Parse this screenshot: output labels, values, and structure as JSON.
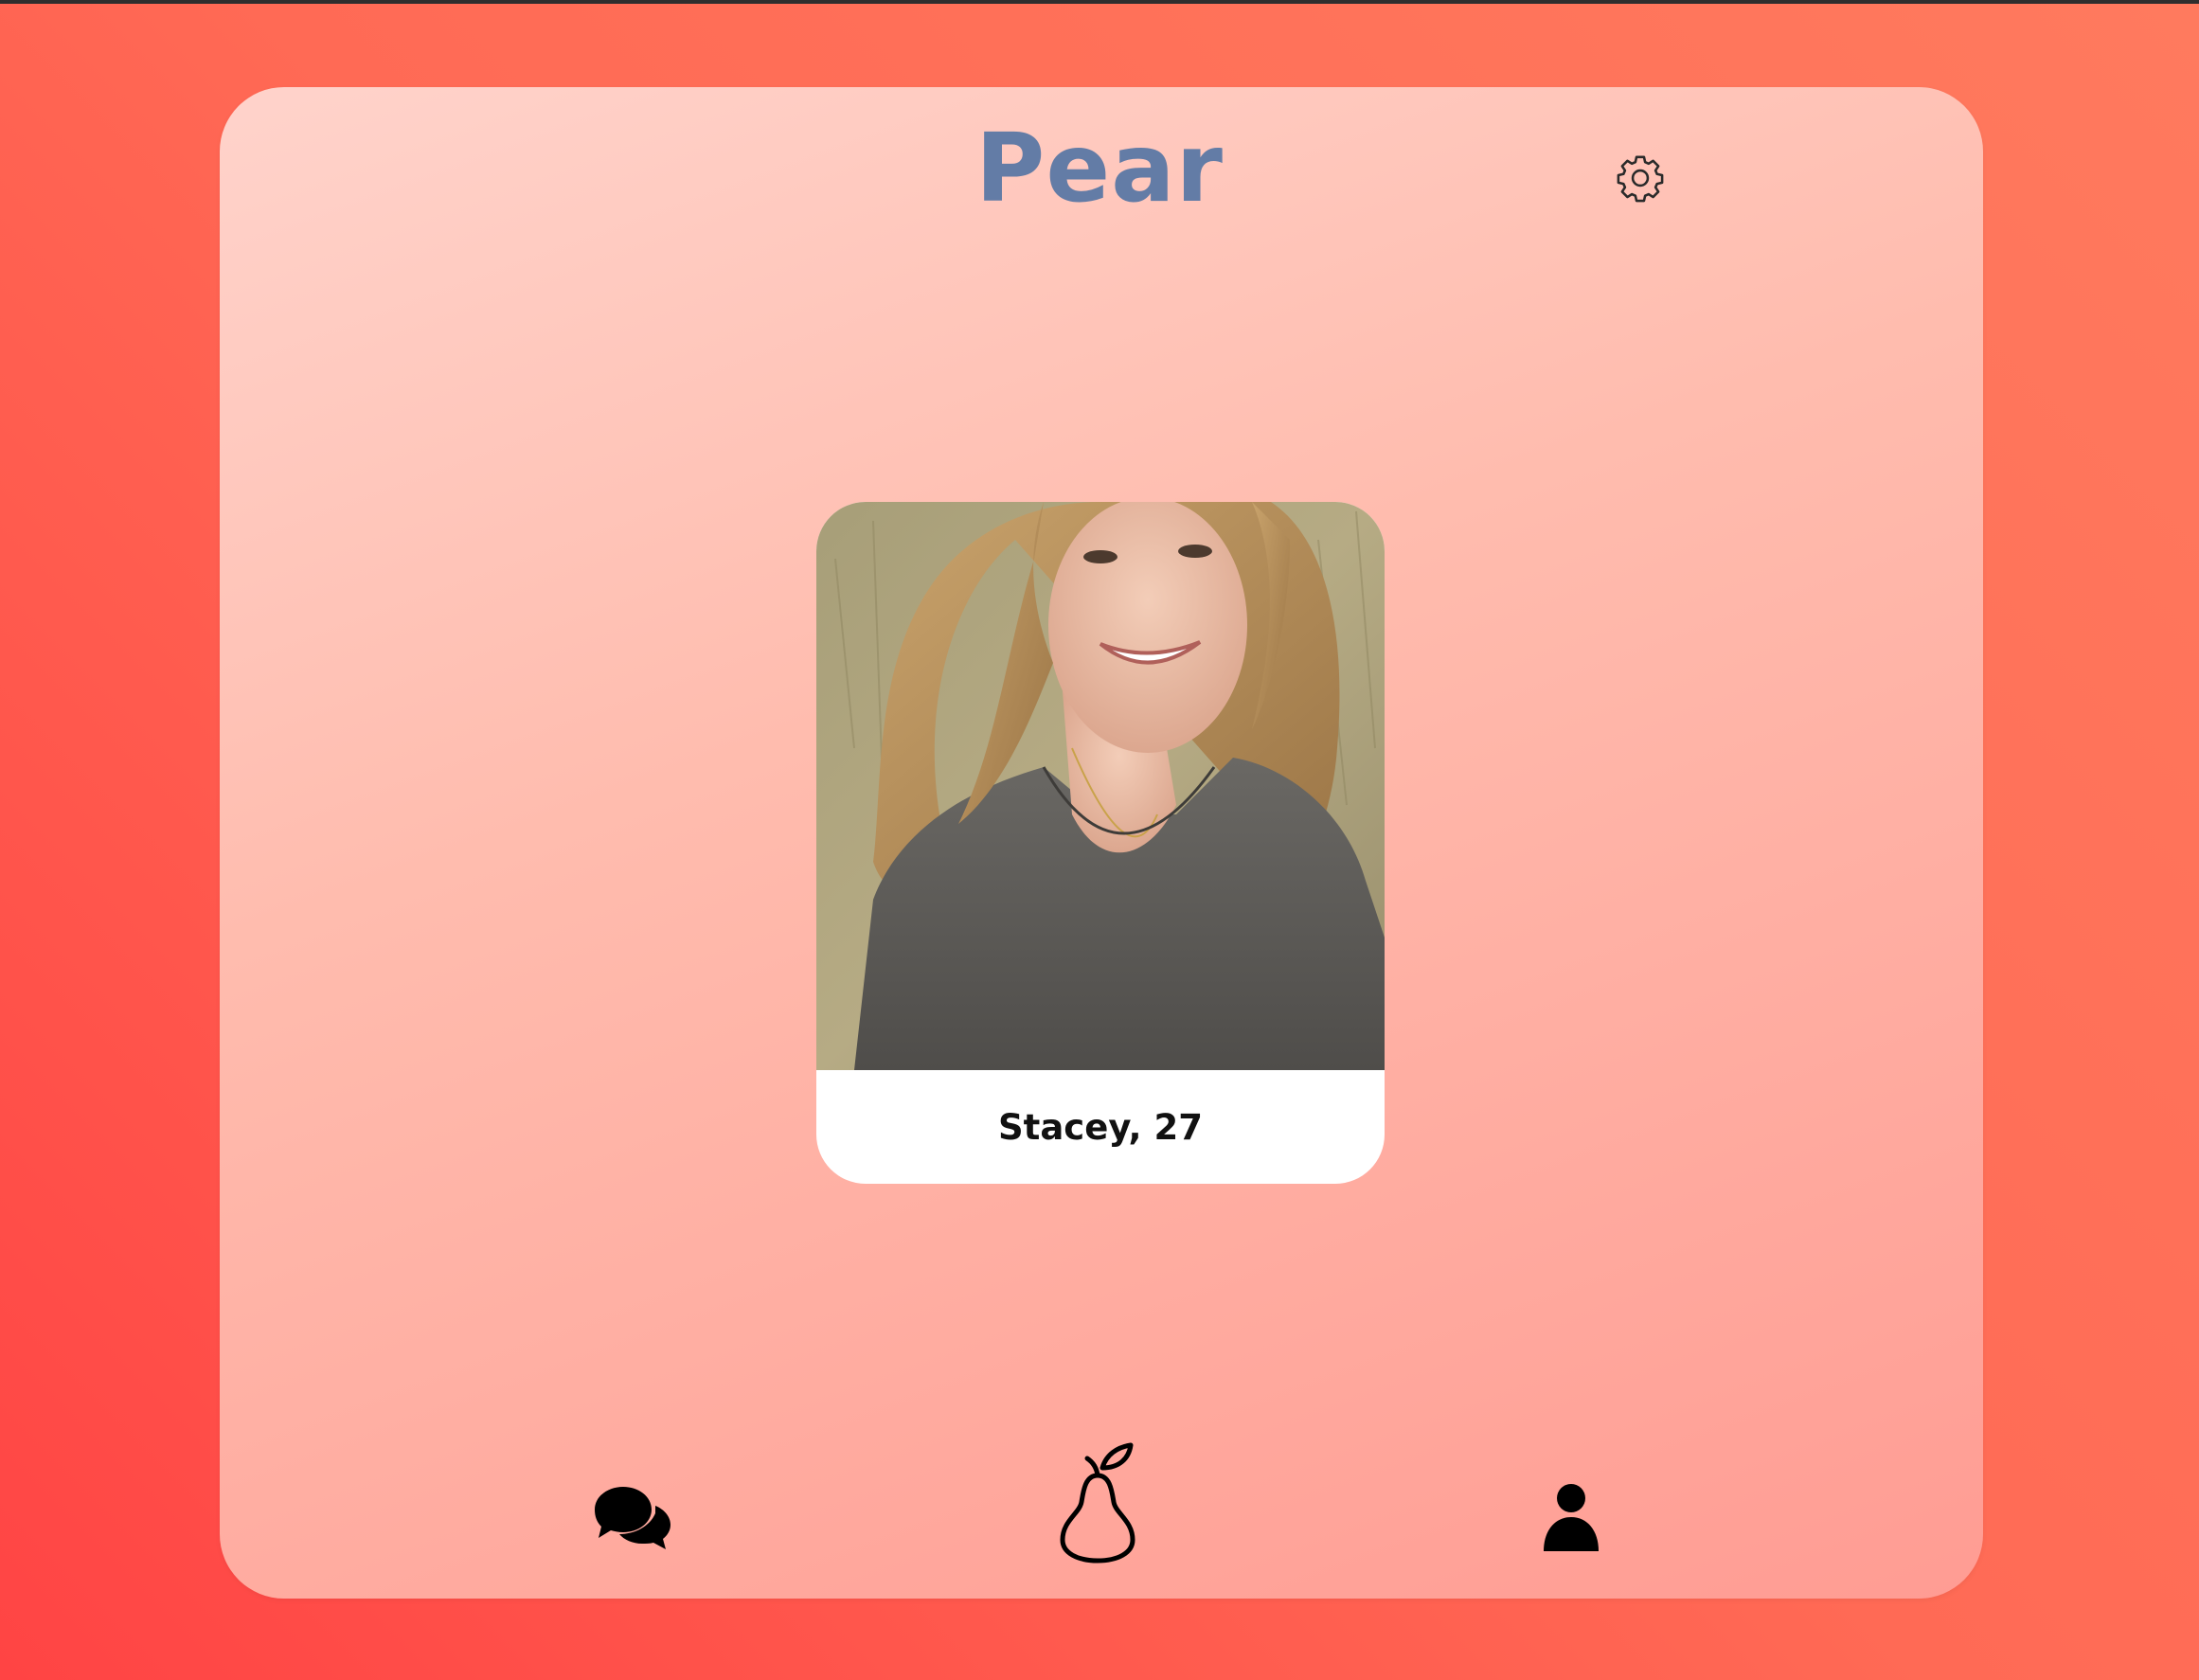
{
  "app": {
    "title": "Pear"
  },
  "header": {
    "settings_icon": "gear-icon"
  },
  "profile_card": {
    "caption": "Stacey, 27",
    "photo": "profile-photo"
  },
  "bottom_nav": {
    "items": [
      {
        "icon": "chat-bubbles-icon"
      },
      {
        "icon": "pear-icon"
      },
      {
        "icon": "person-icon"
      }
    ]
  },
  "colors": {
    "title": "#637ca6",
    "background": "#ff4a45",
    "panel": "#ffbcae",
    "card": "#ffffff"
  }
}
